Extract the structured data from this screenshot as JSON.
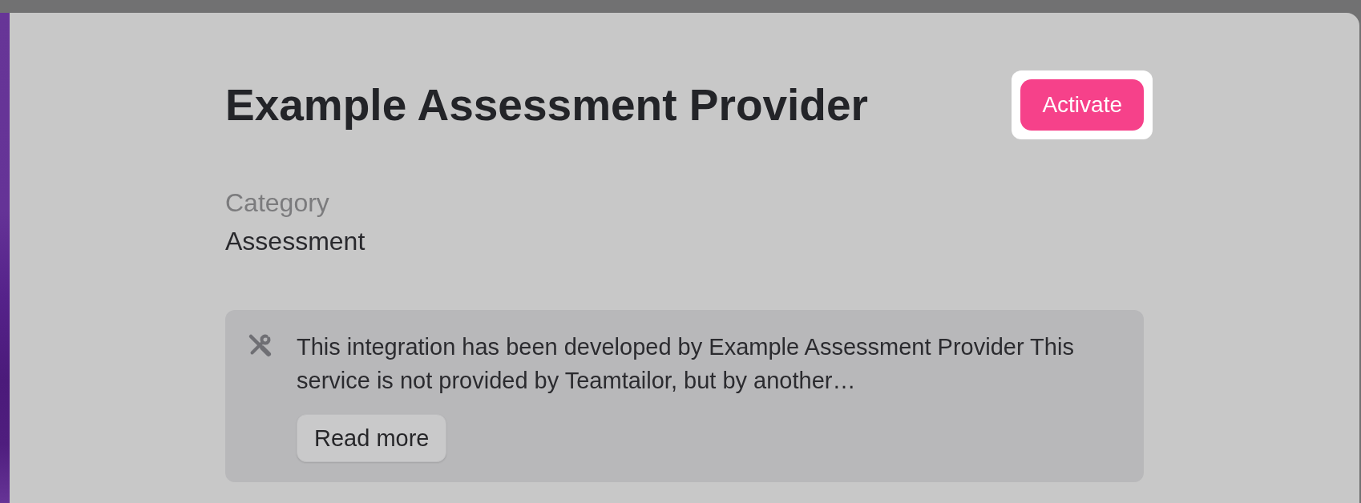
{
  "dialog": {
    "title": "Example Assessment Provider",
    "primary_button": {
      "label": "Activate",
      "focused": true
    },
    "details": [
      {
        "label": "Category",
        "value": "Assessment"
      }
    ],
    "notice": {
      "text": "This integration has been developed by Example Assessment Provider This service is not provided by Teamtailor, but by another…",
      "button": "Read more"
    }
  }
}
